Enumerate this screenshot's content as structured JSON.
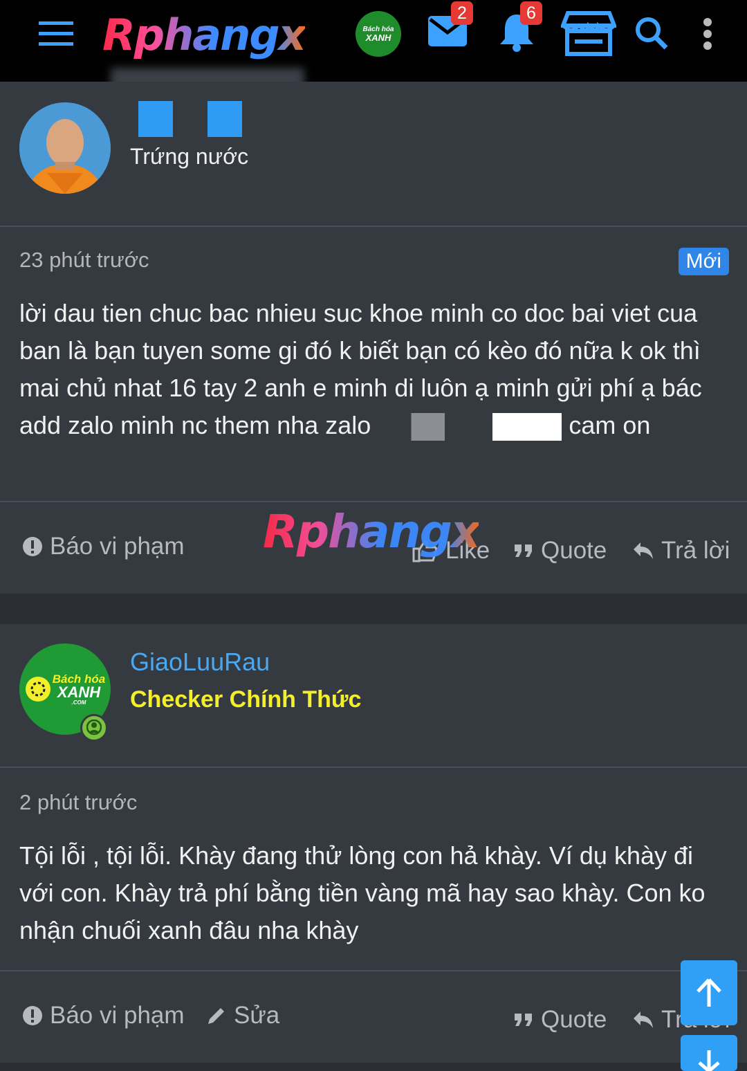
{
  "header": {
    "logo": "Rphangx",
    "brand_small": {
      "line1": "Bách hóa",
      "line2": "XANH"
    },
    "messages_count": "2",
    "notifications_count": "6"
  },
  "posts": [
    {
      "user_rank": "Trứng nước",
      "time": "23 phút trước",
      "new_badge": "Mới",
      "content": "lời dau tien chuc bac nhieu suc khoe minh co doc bai viet cua ban là bạn tuyen some gi đó k biết bạn có kèo đó nữa k ok thì mai chủ nhat 16 tay 2 anh e minh di luôn ạ minh gửi phí ạ bác add zalo minh nc them nha zalo",
      "content_tail": "cam on",
      "actions": {
        "report": "Báo vi phạm",
        "like": "Like",
        "quote": "Quote",
        "reply": "Trả lời"
      }
    },
    {
      "username": "GiaoLuuRau",
      "user_rank": "Checker Chính Thức",
      "avatar_brand": {
        "line1": "Bách hóa",
        "line2": "XANH",
        "line3": ".COM"
      },
      "time": "2 phút trước",
      "content": "Tội lỗi , tội lỗi. Khày đang thử lòng con hả khày. Ví dụ khày đi với con. Khày trả phí bằng tiền vàng mã hay sao khày. Con ko nhận chuối xanh đâu nha khày",
      "actions": {
        "report": "Báo vi phạm",
        "edit": "Sửa",
        "quote": "Quote",
        "reply": "Trả lời"
      }
    }
  ],
  "watermark": "Rphangx",
  "colors": {
    "accent": "#2f86e8",
    "username": "#4aa8f0",
    "rank_highlight": "#f3ef2a",
    "online": "#7cc242"
  }
}
